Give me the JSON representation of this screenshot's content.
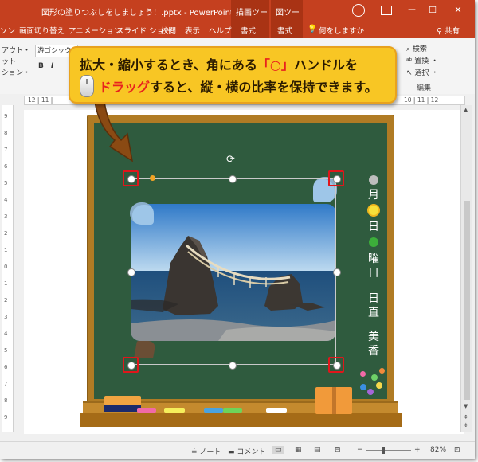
{
  "window": {
    "title": "図形の塗りつぶしをしましょう！.pptx  -  PowerPoint",
    "tool_tab_draw": "描画ツール",
    "tool_tab_picture": "図ツール",
    "controls": [
      "ー",
      "☐",
      "✕"
    ]
  },
  "tabs": [
    "ソン",
    "画面切り替え",
    "アニメーション",
    "スライド ショー",
    "校閲",
    "表示",
    "ヘルプ",
    "書式",
    "書式",
    "何をしますか",
    "共有"
  ],
  "ribbon": {
    "left_items": [
      "アウト・",
      "ット",
      "ション・"
    ],
    "font": "游ゴシック",
    "bold": "B",
    "italic": "I",
    "right_items": [
      "検索",
      "置換 ・",
      "選択 ・"
    ],
    "group_editing": "編集"
  },
  "ruler": {
    "left_marks": "12 | 11 |",
    "right_marks": "10 | 11 | 12"
  },
  "vruler_marks": [
    "9",
    "8",
    "7",
    "6",
    "5",
    "4",
    "3",
    "2",
    "1",
    "0",
    "1",
    "2",
    "3",
    "4",
    "5",
    "6",
    "7",
    "8",
    "9"
  ],
  "callout": {
    "line1_a": "拡大・縮小するとき、角にある",
    "line1_b": "「○」",
    "line1_c": "ハンドルを",
    "line2_a": "ドラッグ",
    "line2_b": "すると、縦・横の比率を保持できます。"
  },
  "board_text": {
    "chars": [
      "月",
      "日",
      "曜",
      "日",
      "日",
      "直",
      "美",
      "香"
    ]
  },
  "status": {
    "notes": "ノート",
    "comments": "コメント",
    "zoom": "82%"
  }
}
